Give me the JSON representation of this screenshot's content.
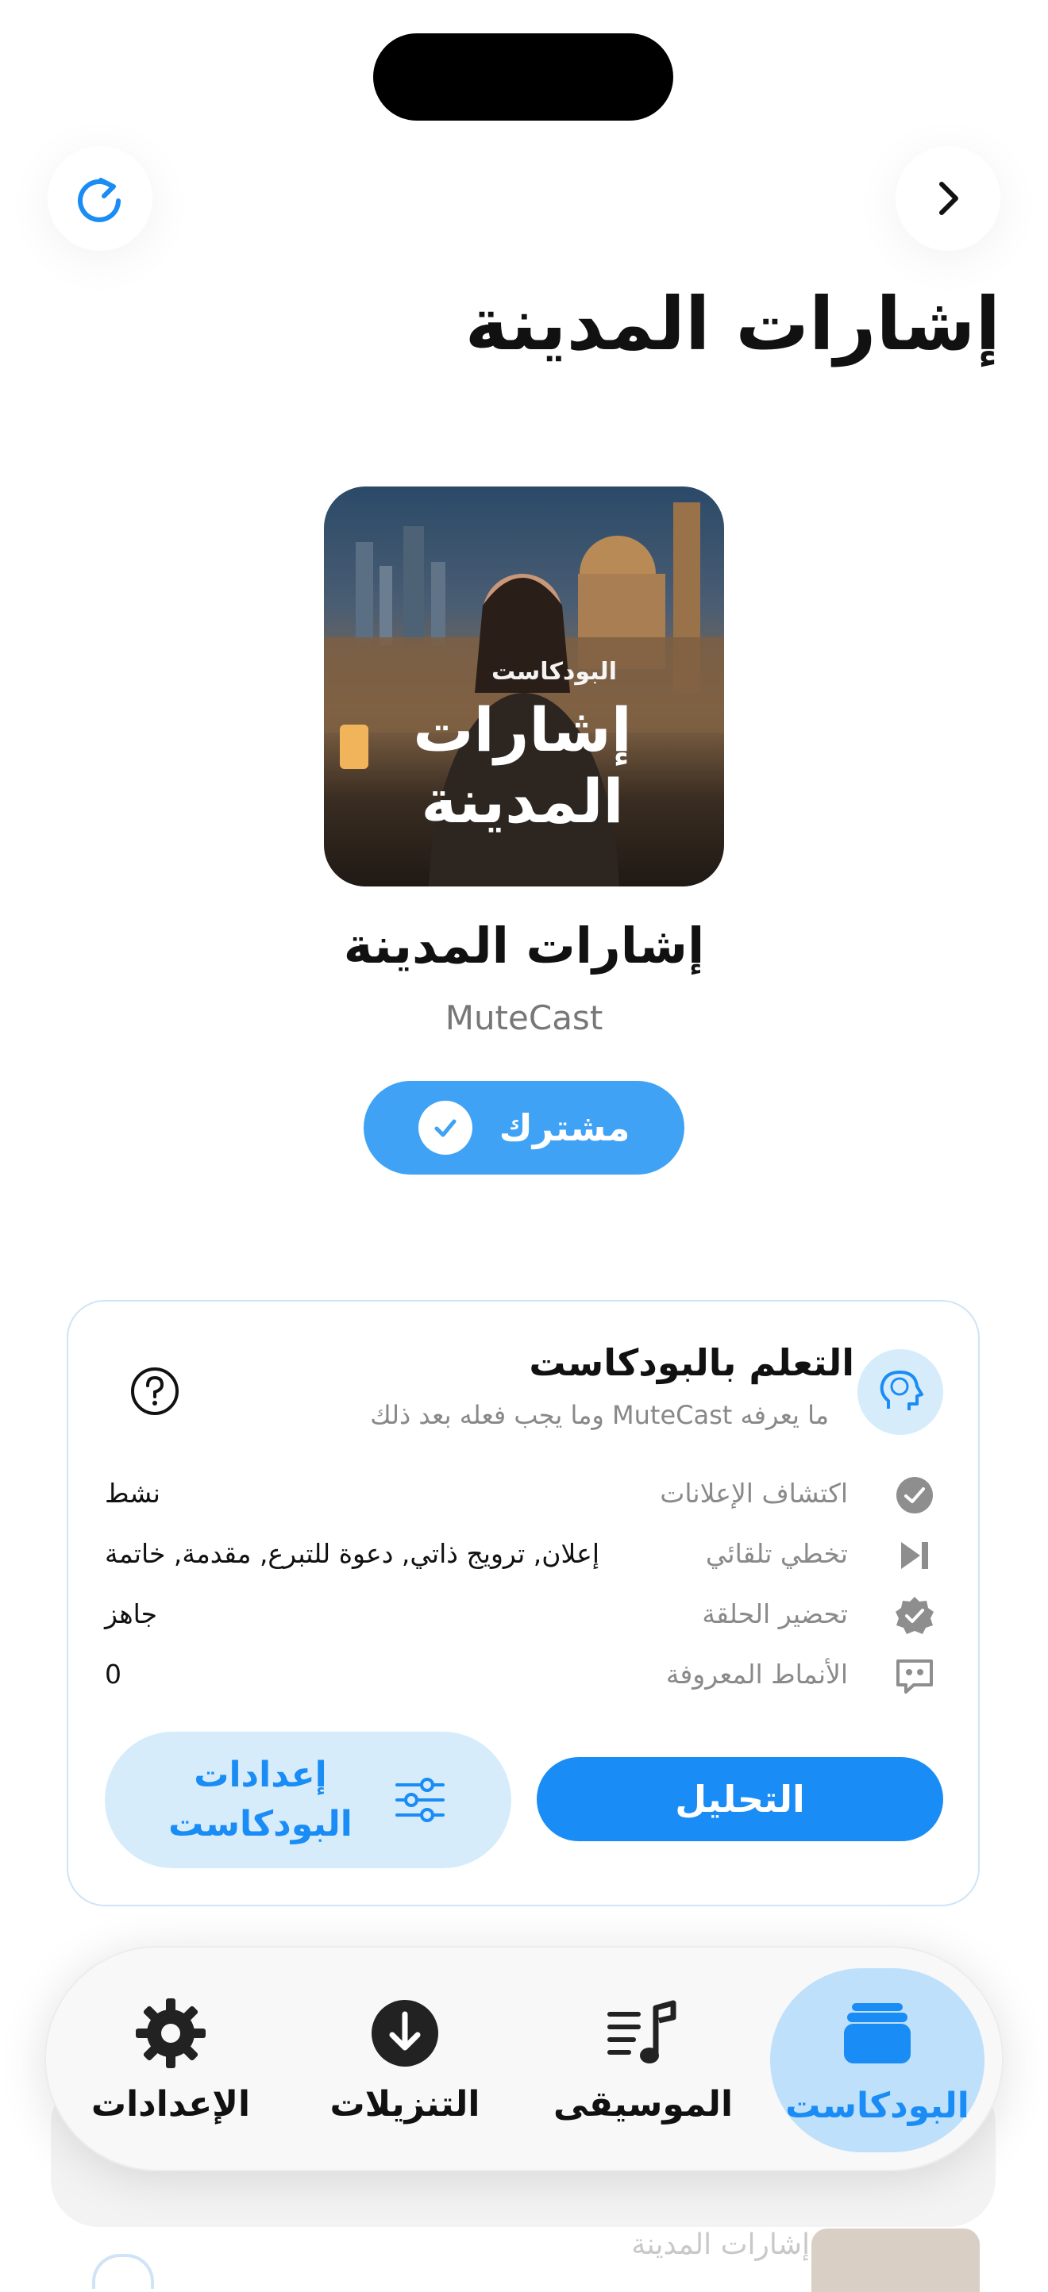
{
  "page": {
    "title": "إشارات المدينة"
  },
  "artwork": {
    "kicker": "البودكاست",
    "title_line1": "إشارات",
    "title_line2": "المدينة"
  },
  "podcast": {
    "name": "إشارات المدينة",
    "publisher": "MuteCast",
    "subscribe_label": "مشترك"
  },
  "learning": {
    "title": "التعلم بالبودكاست",
    "subtitle": "ما يعرفه MuteCast وما يجب فعله بعد ذلك",
    "rows": [
      {
        "label": "اكتشاف الإعلانات",
        "value": "نشط",
        "icon": "check-circle-icon"
      },
      {
        "label": "تخطي تلقائي",
        "value": "إعلان, ترويج ذاتي, دعوة للتبرع, مقدمة, خاتمة",
        "icon": "skip-forward-icon"
      },
      {
        "label": "تحضير الحلقة",
        "value": "جاهز",
        "icon": "verified-badge-icon"
      },
      {
        "label": "الأنماط المعروفة",
        "value": "0",
        "icon": "quote-bubble-icon"
      }
    ],
    "analyze_label": "التحليل",
    "settings_label_line1": "إعدادات",
    "settings_label_line2": "البودكاست"
  },
  "background": {
    "ghost_title": "إشارات المدينة"
  },
  "tabs": [
    {
      "label": "البودكاست",
      "icon": "stack-icon",
      "active": true
    },
    {
      "label": "الموسيقى",
      "icon": "music-list-icon",
      "active": false
    },
    {
      "label": "التنزيلات",
      "icon": "download-icon",
      "active": false
    },
    {
      "label": "الإعدادات",
      "icon": "gear-icon",
      "active": false
    }
  ],
  "colors": {
    "accent": "#1a8cf5",
    "accent_light": "#d6ecfb",
    "subscribe": "#3fa2f5"
  }
}
